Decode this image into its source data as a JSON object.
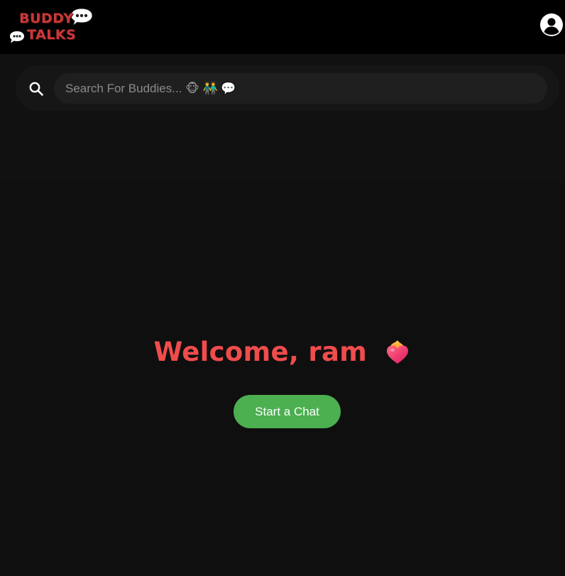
{
  "app": {
    "logo_line1": "BUDDY",
    "logo_line2": "TALKS",
    "logo_icon": "chat-bubble-icon"
  },
  "header": {
    "account_icon": "user-circle-icon"
  },
  "search": {
    "icon": "search-icon",
    "placeholder": "Search For Buddies... 🐵 👬 💬"
  },
  "main": {
    "welcome_text": "Welcome, ram",
    "welcome_emoji_icon": "heart-on-fire-icon",
    "start_chat_label": "Start a Chat"
  },
  "colors": {
    "header_bg": "#000000",
    "page_bg": "#0f0f0f",
    "search_pill_bg": "#161616",
    "search_input_bg": "#1f1f1f",
    "logo_red": "#c9393a",
    "welcome_red": "#f04c4c",
    "button_green": "#4caf50"
  }
}
